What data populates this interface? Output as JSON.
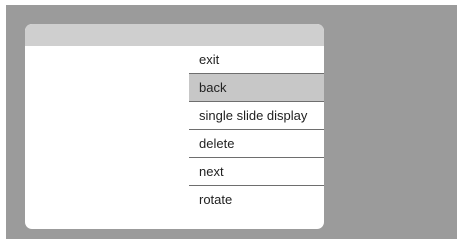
{
  "menu": {
    "items": [
      {
        "label": "exit",
        "selected": false
      },
      {
        "label": "back",
        "selected": true
      },
      {
        "label": "single slide display",
        "selected": false
      },
      {
        "label": "delete",
        "selected": false
      },
      {
        "label": "next",
        "selected": false
      },
      {
        "label": "rotate",
        "selected": false
      }
    ]
  },
  "colors": {
    "backdrop": "#9b9b9b",
    "panel": "#ffffff",
    "panel_header": "#cfcfcf",
    "selected_item": "#c7c7c7",
    "divider": "#6e6e6e"
  }
}
